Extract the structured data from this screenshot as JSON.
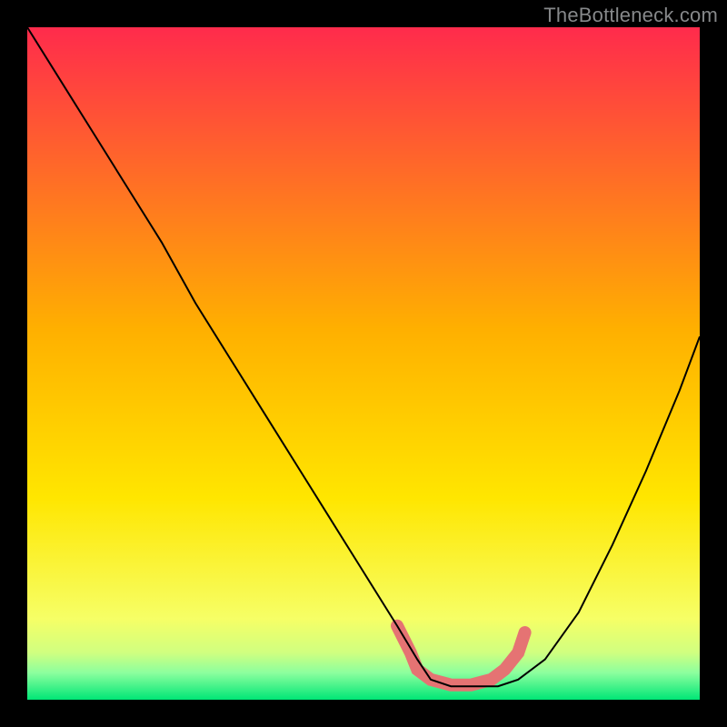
{
  "watermark": "TheBottleneck.com",
  "colors": {
    "bg": "#000000",
    "top": "#ff2b4c",
    "mid": "#ffe600",
    "bottom": "#00e676",
    "curve": "#000000",
    "marker": "#e57373"
  },
  "chart_data": {
    "type": "line",
    "title": "",
    "xlabel": "",
    "ylabel": "",
    "xlim": [
      0,
      100
    ],
    "ylim": [
      0,
      100
    ],
    "grid": false,
    "note": "V-shaped bottleneck curve over rainbow gradient; values read from pixel positions as percentage of plot width/height (y = 0 at bottom)",
    "series": [
      {
        "name": "bottleneck-curve",
        "x": [
          0,
          5,
          10,
          15,
          20,
          25,
          30,
          35,
          40,
          45,
          50,
          55,
          58,
          60,
          63,
          66,
          70,
          73,
          77,
          82,
          87,
          92,
          97,
          100
        ],
        "y": [
          100,
          92,
          84,
          76,
          68,
          59,
          51,
          43,
          35,
          27,
          19,
          11,
          6,
          3,
          2,
          2,
          2,
          3,
          6,
          13,
          23,
          34,
          46,
          54
        ]
      },
      {
        "name": "optimal-marker",
        "x": [
          55,
          57,
          58,
          60,
          63,
          66,
          69,
          71,
          73,
          74
        ],
        "y": [
          11,
          7,
          4.5,
          3,
          2.2,
          2.2,
          3,
          4.5,
          7,
          10
        ]
      }
    ]
  }
}
